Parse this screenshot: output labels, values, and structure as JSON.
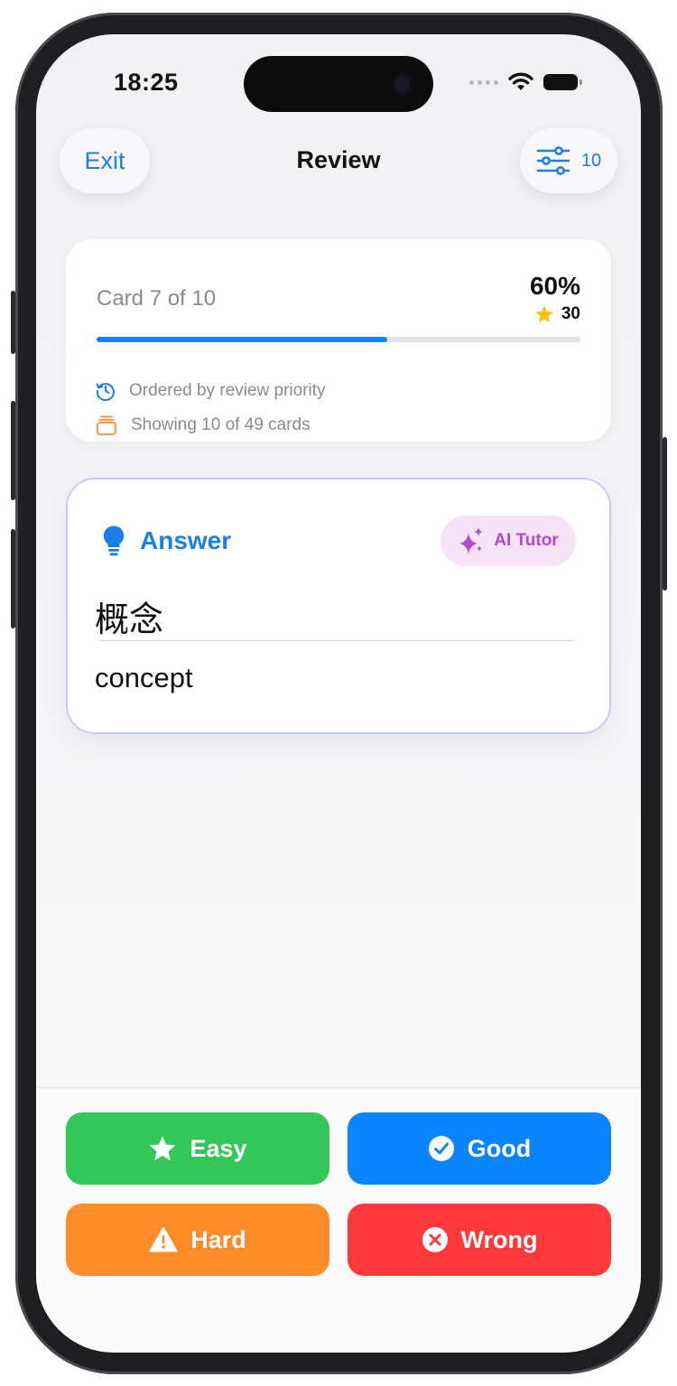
{
  "status": {
    "time": "18:25"
  },
  "nav": {
    "exit_label": "Exit",
    "title": "Review",
    "filter_count": "10"
  },
  "progress": {
    "card_label": "Card 7 of 10",
    "percent_label": "60%",
    "percent_value": 0.6,
    "star_count": "30",
    "order_text": "Ordered by review priority",
    "showing_text": "Showing 10 of 49 cards"
  },
  "answer": {
    "label": "Answer",
    "tutor_label": "AI Tutor",
    "term": "概念",
    "meaning": "concept"
  },
  "grades": {
    "easy": "Easy",
    "good": "Good",
    "hard": "Hard",
    "wrong": "Wrong"
  },
  "colors": {
    "accent": "#1a7fe8",
    "easy": "#34c759",
    "good": "#0b84ff",
    "hard": "#ff8c29",
    "wrong": "#ff383c",
    "tutor": "#b24ad0"
  },
  "icons": {
    "filter": "sliders-icon",
    "star": "star-icon",
    "priority": "clock-history-icon",
    "showing": "cards-stack-icon",
    "answer": "lightbulb-icon",
    "tutor": "sparkles-icon",
    "easy": "star-icon",
    "good": "checkmark-circle-icon",
    "hard": "warning-triangle-icon",
    "wrong": "x-circle-icon"
  }
}
